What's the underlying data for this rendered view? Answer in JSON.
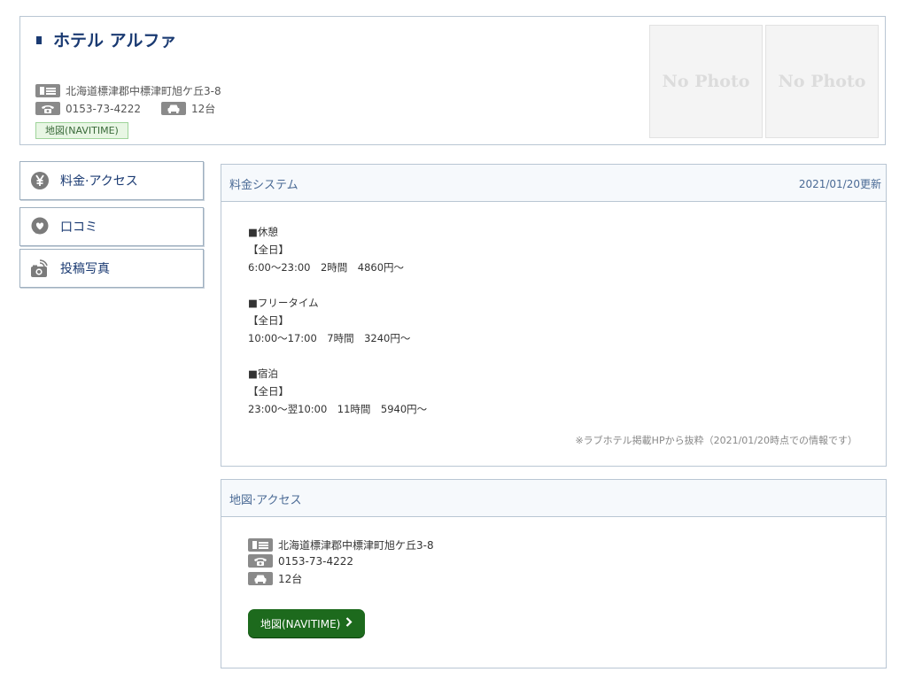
{
  "header": {
    "hotel_name": "ホテル アルファ",
    "address": "北海道標津郡中標津町旭ケ丘3-8",
    "phone": "0153-73-4222",
    "parking": "12台",
    "map_link": "地図(NAVITIME)",
    "photos": [
      "No Photo",
      "No Photo"
    ]
  },
  "nav": {
    "items": [
      {
        "label": "料金·アクセス",
        "icon": "yen-icon"
      },
      {
        "label": "口コミ",
        "icon": "heart-bubble-icon"
      },
      {
        "label": "投稿写真",
        "icon": "camera-icon"
      }
    ]
  },
  "pricing": {
    "title": "料金システム",
    "updated": "2021/01/20更新",
    "lines": [
      "■休憩",
      "【全日】",
      "6:00〜23:00　2時間　4860円〜",
      "",
      "■フリータイム",
      "【全日】",
      "10:00〜17:00　7時間　3240円〜",
      "",
      "■宿泊",
      "【全日】",
      "23:00〜翌10:00　11時間　5940円〜"
    ],
    "note": "※ラブホテル掲載HPから抜粋（2021/01/20時点での情報です）"
  },
  "access": {
    "title": "地図·アクセス",
    "address": "北海道標津郡中標津町旭ケ丘3-8",
    "phone": "0153-73-4222",
    "parking": "12台",
    "button_label": "地図(NAVITIME)"
  },
  "colors": {
    "brand_navy": "#1a3a72",
    "border": "#b9c6d3",
    "button_green": "#1d6a1d"
  }
}
